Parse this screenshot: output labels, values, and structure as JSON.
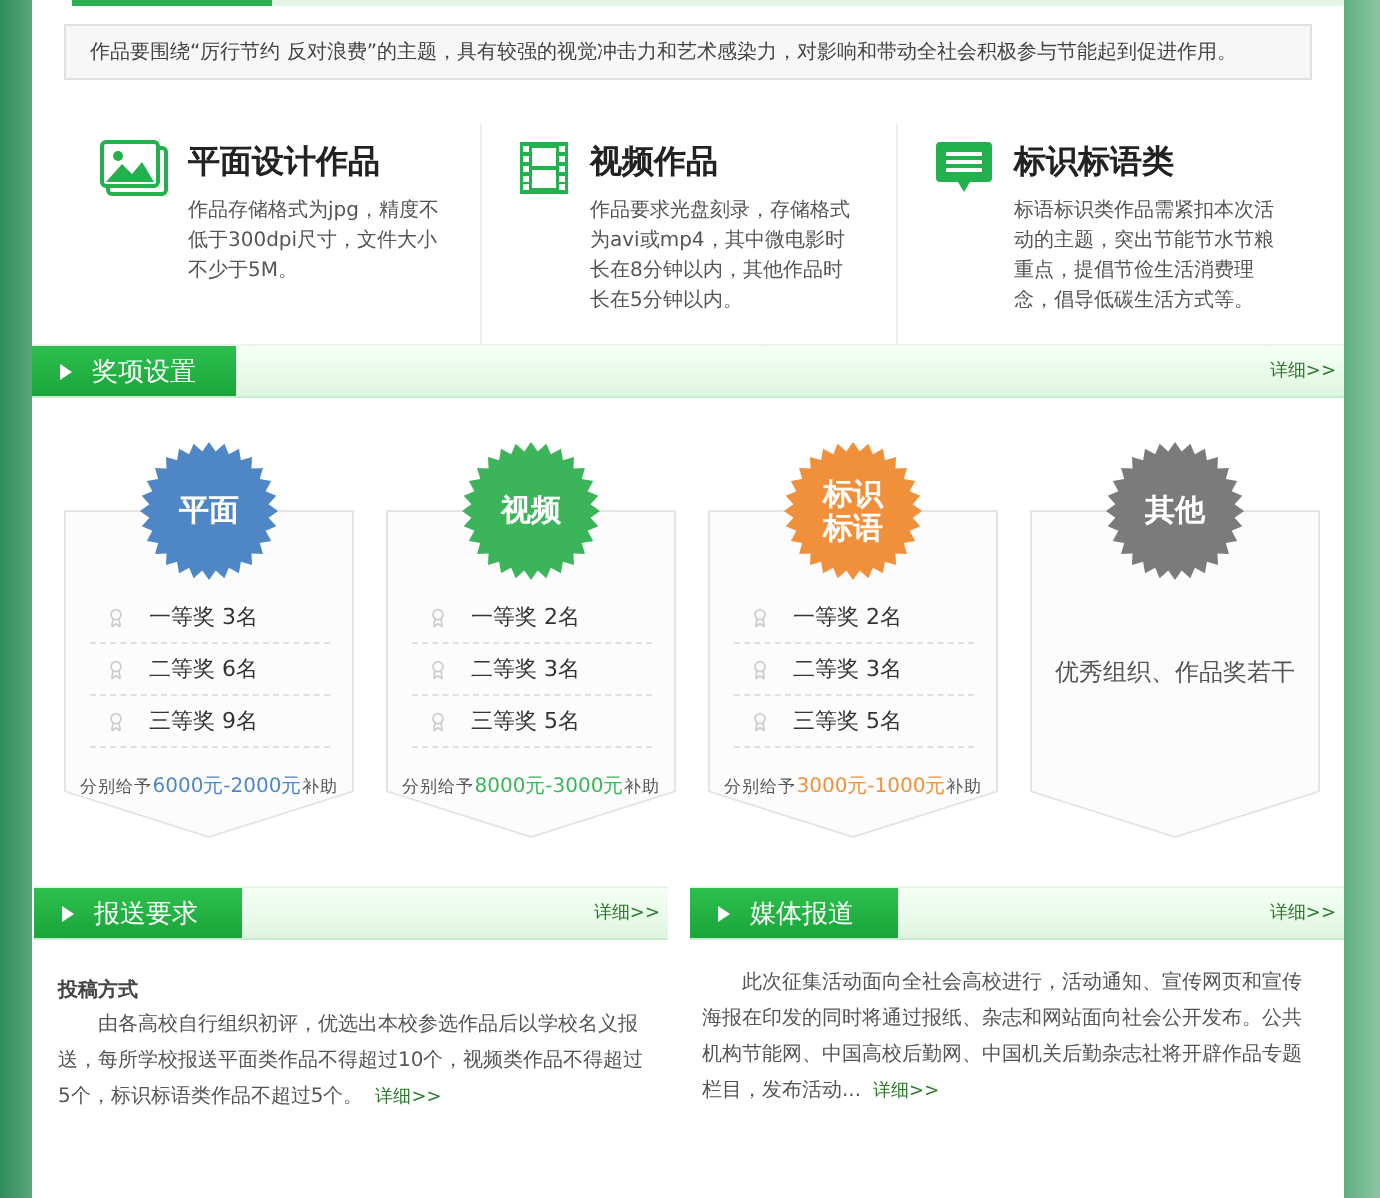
{
  "notice": "作品要围绕“厉行节约 反对浪费”的主题，具有较强的视觉冲击力和艺术感染力，对影响和带动全社会积极参与节能起到促进作用。",
  "features": [
    {
      "kind": "image",
      "title": "平面设计作品",
      "text": "作品存储格式为jpg，精度不低于300dpi尺寸，文件大小不少于5M。"
    },
    {
      "kind": "film",
      "title": "视频作品",
      "text": "作品要求光盘刻录，存储格式为avi或mp4，其中微电影时长在8分钟以内，其他作品时长在5分钟以内。"
    },
    {
      "kind": "chat",
      "title": "标识标语类",
      "text": "标语标识类作品需紧扣本次活动的主题，突出节能节水节粮重点，提倡节俭生活消费理念，倡导低碳生活方式等。"
    }
  ],
  "awards": {
    "title": "奖项设置",
    "more": "详细>>",
    "cards": [
      {
        "kind": "prizes",
        "badge": "平面",
        "color": "#4f86c6",
        "prizes": [
          "一等奖 3名",
          "二等奖 6名",
          "三等奖 9名"
        ],
        "subsidy_prefix": "分别给予",
        "subsidy_amount": "6000元-2000元",
        "subsidy_suffix": "补助"
      },
      {
        "kind": "prizes",
        "badge": "视频",
        "color": "#3cb55a",
        "prizes": [
          "一等奖 2名",
          "二等奖 3名",
          "三等奖 5名"
        ],
        "subsidy_prefix": "分别给予",
        "subsidy_amount": "8000元-3000元",
        "subsidy_suffix": "补助"
      },
      {
        "kind": "prizes",
        "badge": "标识标语",
        "color": "#f0903a",
        "prizes": [
          "一等奖 2名",
          "二等奖 3名",
          "三等奖 5名"
        ],
        "subsidy_prefix": "分别给予",
        "subsidy_amount": "3000元-1000元",
        "subsidy_suffix": "补助"
      },
      {
        "kind": "text",
        "badge": "其他",
        "color": "#7b7b7b",
        "text": "优秀组织、作品奖若干"
      }
    ]
  },
  "submission": {
    "title": "报送要求",
    "more": "详细>>",
    "subtitle": "投稿方式",
    "text": "由各高校自行组织初评，优选出本校参选作品后以学校名义报送，每所学校报送平面类作品不得超过10个，视频类作品不得超过5个，标识标语类作品不超过5个。",
    "link": "详细>>"
  },
  "media": {
    "title": "媒体报道",
    "more": "详细>>",
    "text": "此次征集活动面向全社会高校进行，活动通知、宣传网页和宣传海报在印发的同时将通过报纸、杂志和网站面向社会公开发布。公共机构节能网、中国高校后勤网、中国机关后勤杂志社将开辟作品专题栏目，发布活动...",
    "link": "详细>>"
  }
}
